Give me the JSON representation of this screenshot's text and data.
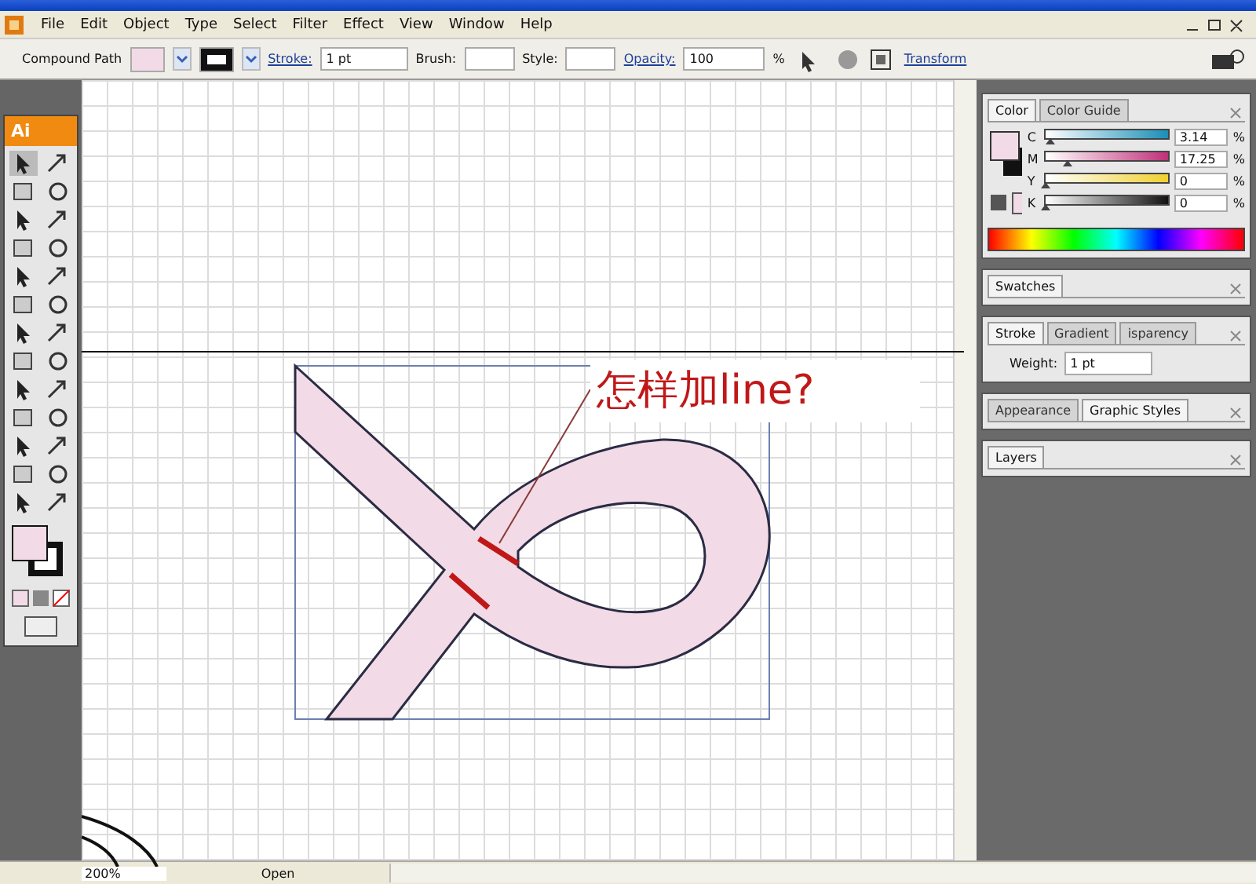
{
  "menu": [
    {
      "label": "File"
    },
    {
      "label": "Edit"
    },
    {
      "label": "Object"
    },
    {
      "label": "Type"
    },
    {
      "label": "Select"
    },
    {
      "label": "Filter"
    },
    {
      "label": "Effect"
    },
    {
      "label": "View"
    },
    {
      "label": "Window"
    },
    {
      "label": "Help"
    }
  ],
  "control_bar": {
    "selection": "Compound Path",
    "stroke_label": "Stroke:",
    "stroke_value": "1 pt",
    "brush_label": "Brush:",
    "style_label": "Style:",
    "opacity_label": "Opacity:",
    "opacity_value": "100",
    "opacity_unit": "%",
    "transform_link": "Transform"
  },
  "toolbox": {
    "logo": "Ai"
  },
  "canvas": {
    "annotation": "怎样加line?"
  },
  "color_panel": {
    "tabs": [
      {
        "label": "Color",
        "selected": true
      },
      {
        "label": "Color Guide",
        "selected": false
      }
    ],
    "sliders": [
      {
        "label": "C",
        "level": 0.03,
        "value": "3.14",
        "unit": "%"
      },
      {
        "label": "M",
        "level": 0.17,
        "value": "17.25",
        "unit": "%"
      },
      {
        "label": "Y",
        "level": 0,
        "value": "0",
        "unit": "%"
      },
      {
        "label": "K",
        "level": 0,
        "value": "0",
        "unit": "%"
      }
    ]
  },
  "swatches_panel": {
    "tabs": [
      {
        "label": "Swatches",
        "selected": true
      }
    ]
  },
  "stroke_panel": {
    "tabs": [
      {
        "label": "Stroke",
        "selected": true
      },
      {
        "label": "Gradient",
        "selected": false
      },
      {
        "label": "isparency",
        "selected": false
      }
    ],
    "weight_label": "Weight:",
    "weight_value": "1 pt"
  },
  "appearance_panel": {
    "tabs": [
      {
        "label": "Appearance",
        "selected": false
      },
      {
        "label": "Graphic Styles",
        "selected": true
      }
    ]
  },
  "layers_panel": {
    "tabs": [
      {
        "label": "Layers",
        "selected": true
      }
    ]
  },
  "status_bar": {
    "zoom": "200%",
    "status": "Open"
  }
}
